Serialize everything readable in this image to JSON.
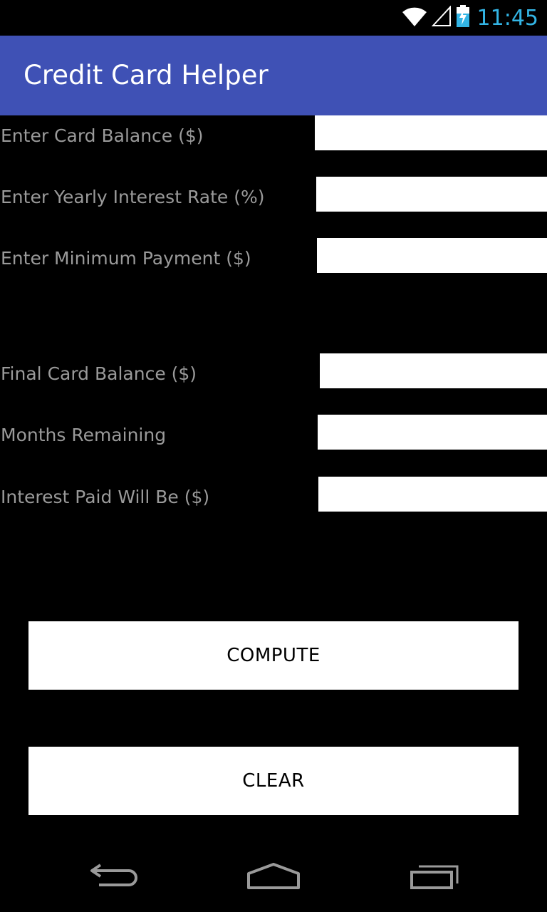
{
  "status_bar": {
    "time": "11:45",
    "icons": [
      "wifi-icon",
      "signal-icon",
      "battery-charging-icon"
    ],
    "time_color": "#33b5e5"
  },
  "app_bar": {
    "title": "Credit Card Helper",
    "color": "#3f51b5"
  },
  "inputs": {
    "card_balance": {
      "label": "Enter Card Balance ($)",
      "value": ""
    },
    "interest_rate": {
      "label": "Enter Yearly Interest Rate (%)",
      "value": ""
    },
    "minimum_payment": {
      "label": "Enter Minimum Payment ($)",
      "value": ""
    }
  },
  "results": {
    "final_balance": {
      "label": "Final Card Balance ($)",
      "value": ""
    },
    "months_remaining": {
      "label": "Months Remaining",
      "value": ""
    },
    "interest_paid": {
      "label": "Interest Paid Will Be ($)",
      "value": ""
    }
  },
  "buttons": {
    "compute": "COMPUTE",
    "clear": "CLEAR"
  },
  "nav_bar": {
    "icons": [
      "back-icon",
      "home-icon",
      "recents-icon"
    ]
  }
}
